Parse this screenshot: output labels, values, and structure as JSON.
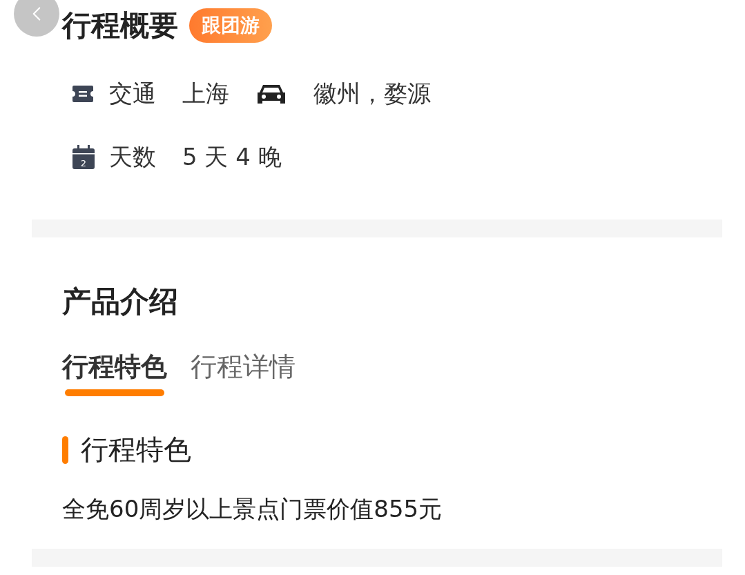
{
  "overview": {
    "title": "行程概要",
    "badge": "跟团游",
    "rows": [
      {
        "kind": "transport",
        "label": "交通",
        "from": "上海",
        "to": "徽州，婺源"
      },
      {
        "kind": "days",
        "label": "天数",
        "value": "5 天 4 晚",
        "calendar_day": "2"
      }
    ]
  },
  "product": {
    "title": "产品介绍",
    "tabs": [
      {
        "label": "行程特色",
        "selected": true
      },
      {
        "label": "行程详情",
        "selected": false
      }
    ],
    "section_title": "行程特色",
    "text": "全免60周岁以上景点门票价值855元"
  }
}
